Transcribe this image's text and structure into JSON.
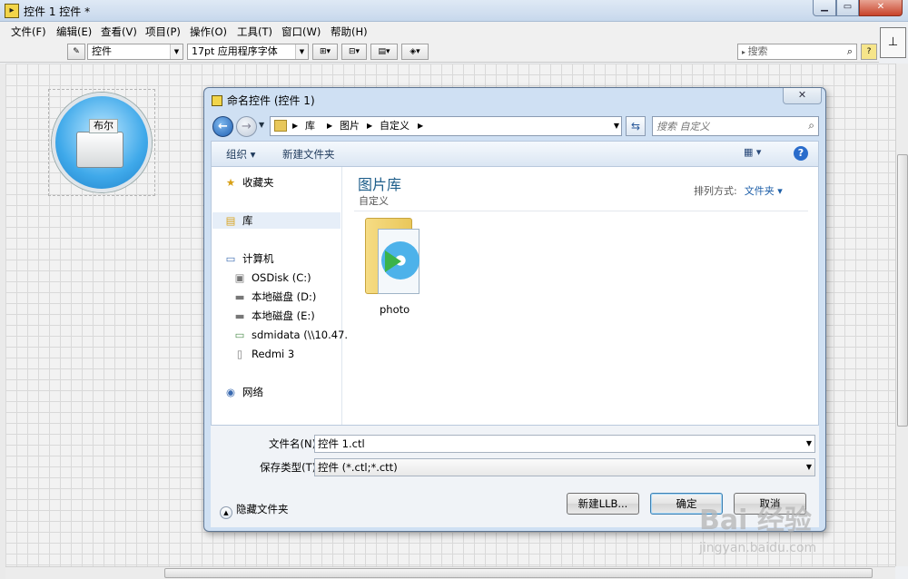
{
  "window": {
    "title": "控件 1 控件 *",
    "app_icon": "labview-icon",
    "controls": {
      "minimize": "▁",
      "maximize": "▭",
      "close": "✕"
    }
  },
  "menubar": {
    "items": [
      "文件(F)",
      "编辑(E)",
      "查看(V)",
      "项目(P)",
      "操作(O)",
      "工具(T)",
      "窗口(W)",
      "帮助(H)"
    ]
  },
  "toolbar": {
    "control_type": "控件",
    "font": "17pt 应用程序字体",
    "align_icons": [
      "align-icon",
      "distribute-icon",
      "resize-icon",
      "reorder-icon"
    ],
    "search_placeholder": "搜索",
    "help": "?"
  },
  "front_panel": {
    "control_label": "布尔"
  },
  "dialog": {
    "title": "命名控件 (控件 1)",
    "close": "✕",
    "breadcrumb": [
      "库",
      "图片",
      "自定义"
    ],
    "search_placeholder": "搜索 自定义",
    "commands": {
      "organize": "组织 ▾",
      "new_folder": "新建文件夹"
    },
    "nav": {
      "favorites": "收藏夹",
      "libraries": "库",
      "computer": "计算机",
      "drives": [
        "OSDisk (C:)",
        "本地磁盘 (D:)",
        "本地磁盘 (E:)",
        "sdmidata (\\\\10.47.",
        "Redmi 3"
      ],
      "network": "网络"
    },
    "content": {
      "library_title": "图片库",
      "library_subtitle": "自定义",
      "arrange_label": "排列方式:",
      "arrange_value": "文件夹 ▾",
      "items": [
        {
          "name": "photo",
          "icon": "picture-folder-icon"
        }
      ]
    },
    "fields": {
      "filename_label": "文件名(N):",
      "filename_value": "控件 1.ctl",
      "filetype_label": "保存类型(T):",
      "filetype_value": "控件 (*.ctl;*.ctt)"
    },
    "hide_folders": "隐藏文件夹",
    "buttons": {
      "new_llb": "新建LLB...",
      "ok": "确定",
      "cancel": "取消"
    }
  },
  "watermark": {
    "line1": "Bai 经验",
    "line2": "jingyan.baidu.com"
  }
}
